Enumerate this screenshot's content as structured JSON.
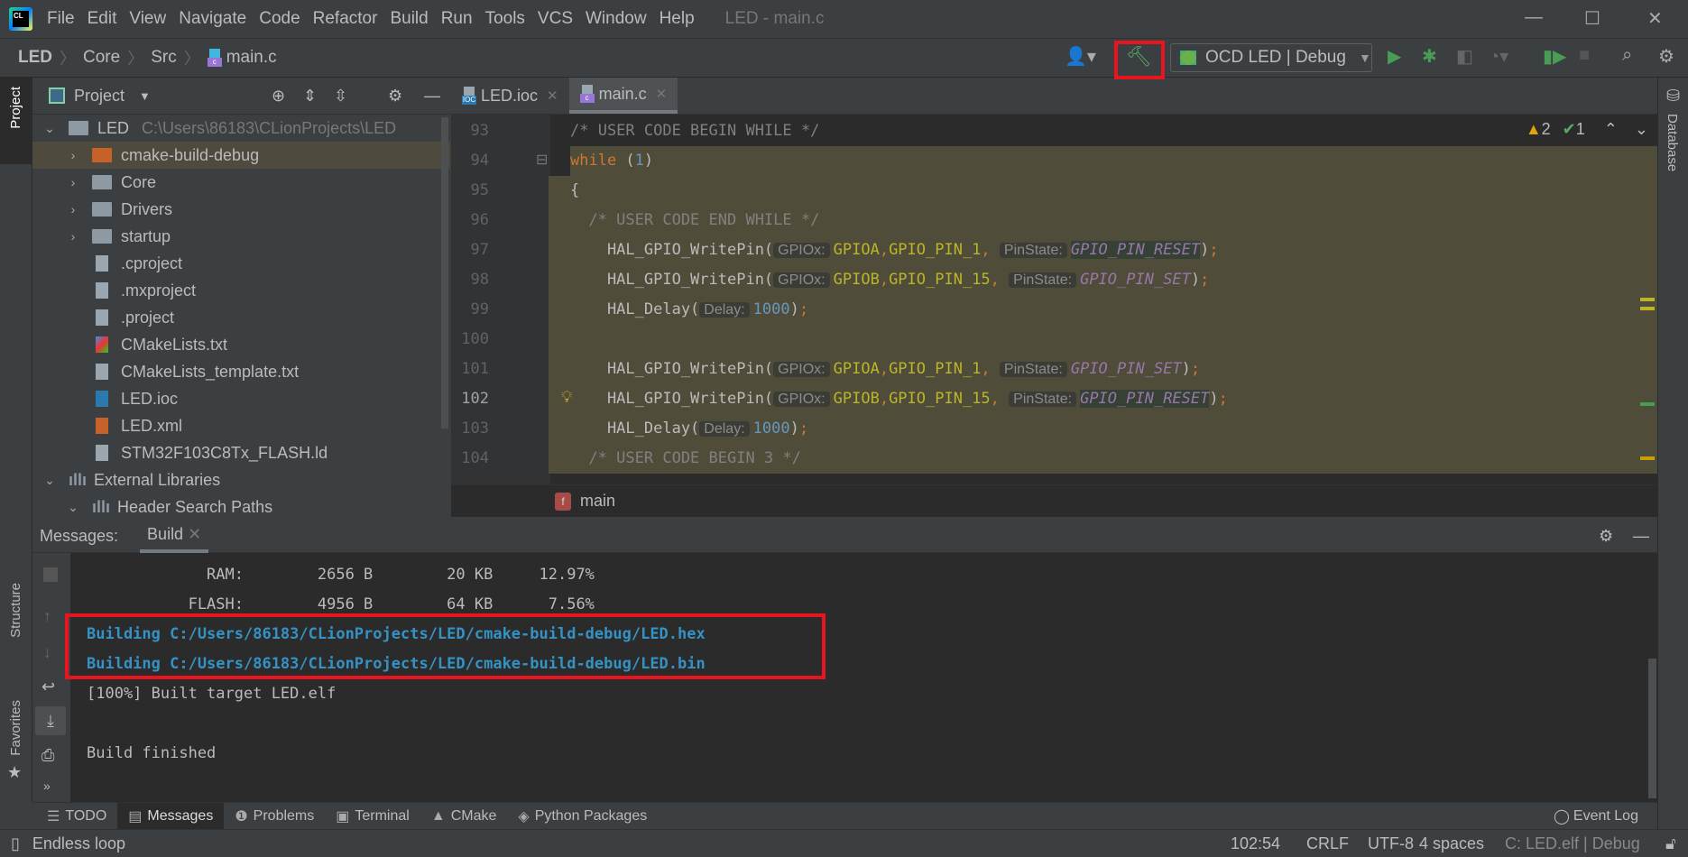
{
  "menu": {
    "items": [
      "File",
      "Edit",
      "View",
      "Navigate",
      "Code",
      "Refactor",
      "Build",
      "Run",
      "Tools",
      "VCS",
      "Window",
      "Help"
    ],
    "window_title": "LED - main.c"
  },
  "breadcrumb": [
    "LED",
    "Core",
    "Src",
    "main.c"
  ],
  "toolbar": {
    "run_config": "OCD LED | Debug",
    "highlight_color": "#e8141e"
  },
  "project_panel": {
    "title": "Project",
    "tree": [
      {
        "label": "LED",
        "hint": "C:\\Users\\86183\\CLionProjects\\LED",
        "level": 0,
        "type": "folder",
        "expanded": true
      },
      {
        "label": "cmake-build-debug",
        "level": 1,
        "type": "folder-orange",
        "expanded": false,
        "selected": true
      },
      {
        "label": "Core",
        "level": 1,
        "type": "folder",
        "expanded": false
      },
      {
        "label": "Drivers",
        "level": 1,
        "type": "folder",
        "expanded": false
      },
      {
        "label": "startup",
        "level": 1,
        "type": "folder",
        "expanded": false
      },
      {
        "label": ".cproject",
        "level": 1,
        "type": "file"
      },
      {
        "label": ".mxproject",
        "level": 1,
        "type": "file"
      },
      {
        "label": ".project",
        "level": 1,
        "type": "file"
      },
      {
        "label": "CMakeLists.txt",
        "level": 1,
        "type": "cmake"
      },
      {
        "label": "CMakeLists_template.txt",
        "level": 1,
        "type": "file"
      },
      {
        "label": "LED.ioc",
        "level": 1,
        "type": "ioc"
      },
      {
        "label": "LED.xml",
        "level": 1,
        "type": "xml"
      },
      {
        "label": "STM32F103C8Tx_FLASH.ld",
        "level": 1,
        "type": "file"
      },
      {
        "label": "External Libraries",
        "level": 0,
        "type": "library",
        "expanded": true
      },
      {
        "label": "Header Search Paths",
        "level": 1,
        "type": "library",
        "expanded": true
      }
    ]
  },
  "left_strip": {
    "project": "Project",
    "structure": "Structure",
    "favorites": "Favorites"
  },
  "right_strip": {
    "database": "Database"
  },
  "editor": {
    "tabs": [
      {
        "label": "LED.ioc",
        "icon": "ioc",
        "active": false
      },
      {
        "label": "main.c",
        "icon": "c",
        "active": true
      }
    ],
    "inspections": {
      "warnings": "2",
      "weak_warnings": "1"
    },
    "current_line": 102,
    "lines": [
      {
        "n": 93,
        "hl": false,
        "tokens": [
          [
            "/* USER CODE BEGIN WHILE */",
            "cmt"
          ]
        ]
      },
      {
        "n": 94,
        "hl": "partial",
        "tokens": [
          [
            "while",
            "kw"
          ],
          [
            " (",
            "txt"
          ],
          [
            "1",
            "num"
          ],
          [
            ")",
            "txt"
          ]
        ]
      },
      {
        "n": 95,
        "hl": true,
        "tokens": [
          [
            "{",
            "txt"
          ]
        ]
      },
      {
        "n": 96,
        "hl": true,
        "tokens": [
          [
            "  /* USER CODE END WHILE */",
            "cmt"
          ]
        ]
      },
      {
        "n": 97,
        "hl": true,
        "tokens": [
          [
            "    HAL_GPIO_WritePin(",
            "fn"
          ],
          [
            "GPIOx:",
            "hint"
          ],
          [
            "GPIOA",
            "mac"
          ],
          [
            ",",
            "punc"
          ],
          [
            "GPIO_PIN_1",
            "mac"
          ],
          [
            ", ",
            "punc"
          ],
          [
            "PinState:",
            "hint"
          ],
          [
            "GPIO_PIN_RESET",
            "enumhl"
          ],
          [
            ")",
            "txt"
          ],
          [
            ";",
            "punc"
          ]
        ]
      },
      {
        "n": 98,
        "hl": true,
        "tokens": [
          [
            "    HAL_GPIO_WritePin(",
            "fn"
          ],
          [
            "GPIOx:",
            "hint"
          ],
          [
            "GPIOB",
            "mac"
          ],
          [
            ",",
            "punc"
          ],
          [
            "GPIO_PIN_15",
            "mac"
          ],
          [
            ", ",
            "punc"
          ],
          [
            "PinState:",
            "hint"
          ],
          [
            "GPIO_PIN_SET",
            "enum"
          ],
          [
            ")",
            "txt"
          ],
          [
            ";",
            "punc"
          ]
        ]
      },
      {
        "n": 99,
        "hl": true,
        "tokens": [
          [
            "    HAL_Delay(",
            "fn"
          ],
          [
            "Delay:",
            "hint"
          ],
          [
            "1000",
            "num"
          ],
          [
            ")",
            "txt"
          ],
          [
            ";",
            "punc"
          ]
        ]
      },
      {
        "n": 100,
        "hl": true,
        "tokens": []
      },
      {
        "n": 101,
        "hl": true,
        "tokens": [
          [
            "    HAL_GPIO_WritePin(",
            "fn"
          ],
          [
            "GPIOx:",
            "hint"
          ],
          [
            "GPIOA",
            "mac"
          ],
          [
            ",",
            "punc"
          ],
          [
            "GPIO_PIN_1",
            "mac"
          ],
          [
            ", ",
            "punc"
          ],
          [
            "PinState:",
            "hint"
          ],
          [
            "GPIO_PIN_SET",
            "enum"
          ],
          [
            ")",
            "txt"
          ],
          [
            ";",
            "punc"
          ]
        ]
      },
      {
        "n": 102,
        "hl": true,
        "tokens": [
          [
            "    HAL_GPIO_WritePin(",
            "fn"
          ],
          [
            "GPIOx:",
            "hint"
          ],
          [
            "GPIOB",
            "mac"
          ],
          [
            ",",
            "punc"
          ],
          [
            "GPIO_PIN_15",
            "mac"
          ],
          [
            ", ",
            "punc"
          ],
          [
            "PinState:",
            "hint"
          ],
          [
            "GPIO_PIN_RESET",
            "enumhl"
          ],
          [
            ")",
            "txt"
          ],
          [
            ";",
            "punc"
          ]
        ]
      },
      {
        "n": 103,
        "hl": true,
        "tokens": [
          [
            "    HAL_Delay(",
            "fn"
          ],
          [
            "Delay:",
            "hint"
          ],
          [
            "1000",
            "num"
          ],
          [
            ")",
            "txt"
          ],
          [
            ";",
            "punc"
          ]
        ]
      },
      {
        "n": 104,
        "hl": true,
        "tokens": [
          [
            "  /* USER CODE BEGIN 3 */",
            "cmt"
          ]
        ]
      }
    ],
    "function_breadcrumb": "main"
  },
  "messages": {
    "label": "Messages:",
    "tab": "Build",
    "output": [
      {
        "text": "             RAM:        2656 B        20 KB     12.97%",
        "blue": false
      },
      {
        "text": "           FLASH:        4956 B        64 KB      7.56%",
        "blue": false
      },
      {
        "text": "Building C:/Users/86183/CLionProjects/LED/cmake-build-debug/LED.hex",
        "blue": true
      },
      {
        "text": "Building C:/Users/86183/CLionProjects/LED/cmake-build-debug/LED.bin",
        "blue": true
      },
      {
        "text": "[100%] Built target LED.elf",
        "blue": false
      },
      {
        "text": "",
        "blue": false
      },
      {
        "text": "Build finished",
        "blue": false
      }
    ]
  },
  "tool_windows": [
    {
      "label": "TODO",
      "icon": "list-icon"
    },
    {
      "label": "Messages",
      "icon": "messages-icon",
      "active": true
    },
    {
      "label": "Problems",
      "icon": "problems-icon"
    },
    {
      "label": "Terminal",
      "icon": "terminal-icon"
    },
    {
      "label": "CMake",
      "icon": "cmake-icon"
    },
    {
      "label": "Python Packages",
      "icon": "packages-icon"
    }
  ],
  "event_log": "Event Log",
  "status": {
    "message": "Endless loop",
    "position": "102:54",
    "line_sep": "CRLF",
    "encoding": "UTF-8",
    "indent": "4 spaces",
    "context": "C: LED.elf | Debug"
  }
}
